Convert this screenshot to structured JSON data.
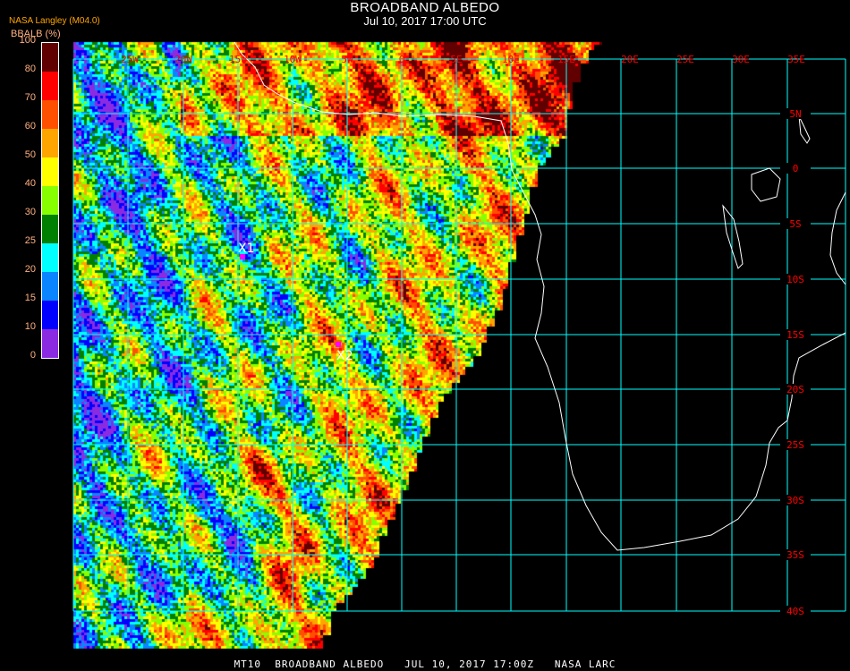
{
  "header": {
    "title": "BROADBAND ALBEDO",
    "subtitle": "Jul 10, 2017 17:00 UTC",
    "source": "NASA Langley (M04.0)"
  },
  "colorbar": {
    "label": "BBALB (%)",
    "ticks": [
      "0",
      "10",
      "15",
      "20",
      "25",
      "30",
      "40",
      "50",
      "60",
      "70",
      "80",
      "100"
    ],
    "colors": [
      "#8a2be2",
      "#0000ff",
      "#0a84ff",
      "#00ffff",
      "#008000",
      "#88ff00",
      "#ffff00",
      "#ffa500",
      "#ff5000",
      "#ff0000",
      "#600000"
    ]
  },
  "map": {
    "lon_labels": [
      "25W",
      "20W",
      "15W",
      "10W",
      "5W",
      "0",
      "5E",
      "10E",
      "15E",
      "20E",
      "25E",
      "30E",
      "35E"
    ],
    "lat_labels": [
      "5N",
      "0",
      "5S",
      "10S",
      "15S",
      "20S",
      "25S",
      "30S",
      "35S",
      "40S"
    ],
    "markers": [
      {
        "label": "X1"
      },
      {
        "label": "X2"
      }
    ],
    "grid_color": "#00ffff",
    "label_color": "#ff0000",
    "coast_color": "#ffffff"
  },
  "footer": "MT10  BROADBAND ALBEDO   JUL 10, 2017 17:00Z   NASA LARC"
}
